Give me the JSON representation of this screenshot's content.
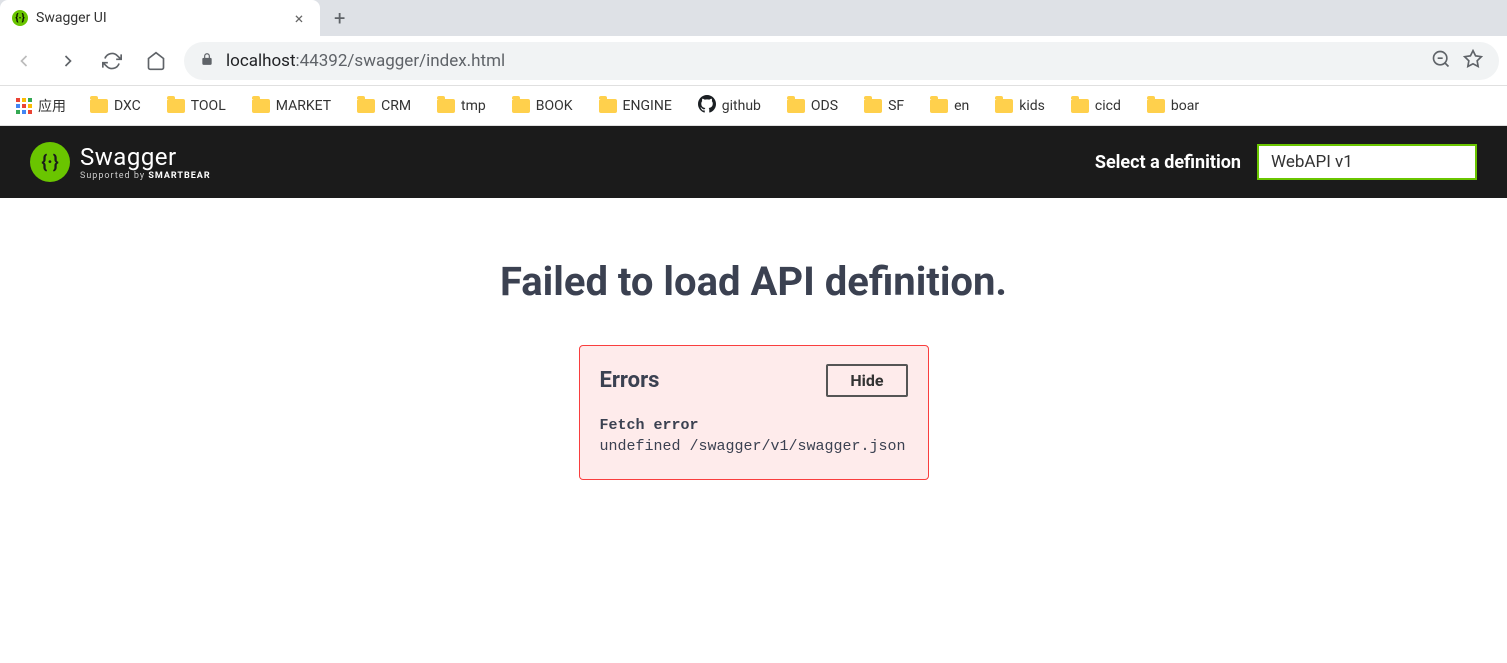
{
  "browser": {
    "tab_title": "Swagger UI",
    "url_host": "localhost",
    "url_port": ":44392",
    "url_path": "/swagger/index.html",
    "apps_label": "应用",
    "bookmarks": [
      {
        "label": "DXC",
        "type": "folder"
      },
      {
        "label": "TOOL",
        "type": "folder"
      },
      {
        "label": "MARKET",
        "type": "folder"
      },
      {
        "label": "CRM",
        "type": "folder"
      },
      {
        "label": "tmp",
        "type": "folder"
      },
      {
        "label": "BOOK",
        "type": "folder"
      },
      {
        "label": "ENGINE",
        "type": "folder"
      },
      {
        "label": "github",
        "type": "github"
      },
      {
        "label": "ODS",
        "type": "folder"
      },
      {
        "label": "SF",
        "type": "folder"
      },
      {
        "label": "en",
        "type": "folder"
      },
      {
        "label": "kids",
        "type": "folder"
      },
      {
        "label": "cicd",
        "type": "folder"
      },
      {
        "label": "boar",
        "type": "folder"
      }
    ]
  },
  "swagger": {
    "logo_name": "Swagger",
    "logo_supported": "Supported by ",
    "logo_company": "SMARTBEAR",
    "select_label": "Select a definition",
    "definition_value": "WebAPI v1"
  },
  "error": {
    "title": "Failed to load API definition.",
    "box_title": "Errors",
    "hide_label": "Hide",
    "detail_title": "Fetch error",
    "detail_body": "undefined /swagger/v1/swagger.json"
  }
}
